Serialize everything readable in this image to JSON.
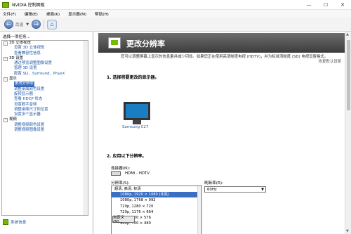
{
  "window": {
    "title": "NVIDIA 控制面板",
    "minimize": "—",
    "maximize": "☐",
    "close": "✕"
  },
  "menu": [
    "文件(F)",
    "编辑(E)",
    "桌面(K)",
    "显示器(M)",
    "帮助(H)"
  ],
  "toolbar": {
    "back_label": "后退",
    "back_icon": "arrow-left-icon",
    "forward_icon": "arrow-right-icon",
    "home_icon": "home-icon"
  },
  "sidebar": {
    "task_label": "选择一项任务...",
    "categories": [
      {
        "label": "3D 立体视觉",
        "items": [
          "设置 3D 立体视觉",
          "查看兼容性信息"
        ]
      },
      {
        "label": "3D 设置",
        "items": [
          "通过预览调整图像设置",
          "管理 3D 设置",
          "配置 SLI、Surround、PhysX"
        ]
      },
      {
        "label": "显示",
        "items": [
          "更改分辨率",
          "调整桌面颜色设置",
          "旋转显示器",
          "查看 HDCP 状态",
          "设置数字音频",
          "调整桌面尺寸和位置",
          "设置多个显示器"
        ]
      },
      {
        "label": "视频",
        "items": [
          "调整视频颜色设置",
          "调整视频图像设置"
        ]
      }
    ],
    "selected": "更改分辨率",
    "system_info": "系统信息"
  },
  "main": {
    "title": "更改分辨率",
    "restore": "恢复默认设置",
    "description": "您可以调整屏幕上显示的信息量并减少闪烁。如果您正在使用高清晰度电视 (HDTV)，并为标准清晰度 (SD) 电视设置格式。",
    "step1": "1.  选择将要更改的显示器。",
    "monitor_label": "Samsung C27",
    "step2": "2.  应用以下分辨率。",
    "connector_label": "连接器(N):",
    "connector_value": "HDMI - HDTV",
    "resolution_label": "分辨率(S):",
    "resolutions": [
      {
        "label": "超清, 高清, 标清",
        "category": true
      },
      {
        "label": "1080p, 1920 × 1080 (本机)",
        "selected": true
      },
      {
        "label": "1080p, 1768 × 992"
      },
      {
        "label": "720p, 1280 × 720"
      },
      {
        "label": "720p, 1176 × 664"
      },
      {
        "label": "576p, 720 × 576"
      },
      {
        "label": "480p, 720 × 480"
      }
    ],
    "refresh_label": "刷新率(R):",
    "refresh_value": "60Hz",
    "custom_button": "自定义(M)..."
  }
}
